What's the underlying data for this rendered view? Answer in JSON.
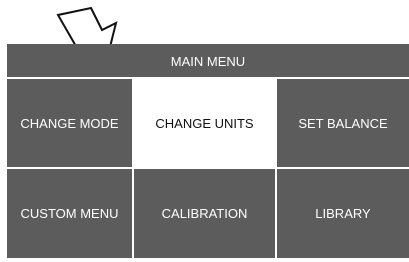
{
  "menu": {
    "title": "MAIN MENU",
    "items": [
      {
        "label": "CHANGE MODE",
        "selected": false
      },
      {
        "label": "CHANGE UNITS",
        "selected": true
      },
      {
        "label": "SET BALANCE",
        "selected": false
      },
      {
        "label": "CUSTOM MENU",
        "selected": false
      },
      {
        "label": "CALIBRATION",
        "selected": false
      },
      {
        "label": "LIBRARY",
        "selected": false
      }
    ]
  },
  "colors": {
    "panel": "#5c5c5c",
    "selected_background": "#ffffff",
    "text": "#ffffff",
    "selected_text": "#111111"
  },
  "icons": {
    "pointer": "pointer-arrow-icon"
  }
}
